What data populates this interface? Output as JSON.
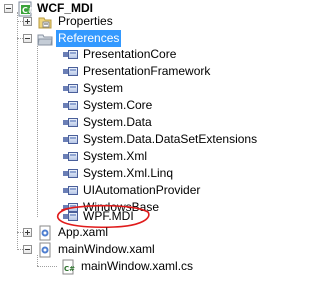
{
  "tree": {
    "project": {
      "label": "WCF_MDI",
      "icon": "csharp-project-icon"
    },
    "properties": {
      "label": "Properties",
      "icon": "properties-icon"
    },
    "references": {
      "label": "References",
      "icon": "references-folder-icon",
      "items": [
        {
          "label": "PresentationCore"
        },
        {
          "label": "PresentationFramework"
        },
        {
          "label": "System"
        },
        {
          "label": "System.Core"
        },
        {
          "label": "System.Data"
        },
        {
          "label": "System.Data.DataSetExtensions"
        },
        {
          "label": "System.Xml"
        },
        {
          "label": "System.Xml.Linq"
        },
        {
          "label": "UIAutomationProvider"
        },
        {
          "label": "WindowsBase"
        },
        {
          "label": "WPF.MDI"
        }
      ]
    },
    "app_xaml": {
      "label": "App.xaml",
      "icon": "xaml-file-icon"
    },
    "main_window": {
      "label": "mainWindow.xaml",
      "icon": "xaml-file-icon"
    },
    "main_window_cs": {
      "label": "mainWindow.xaml.cs",
      "icon": "csharp-file-icon"
    }
  },
  "colors": {
    "selection": "#3399ff",
    "highlight_circle": "#e01b1b"
  }
}
